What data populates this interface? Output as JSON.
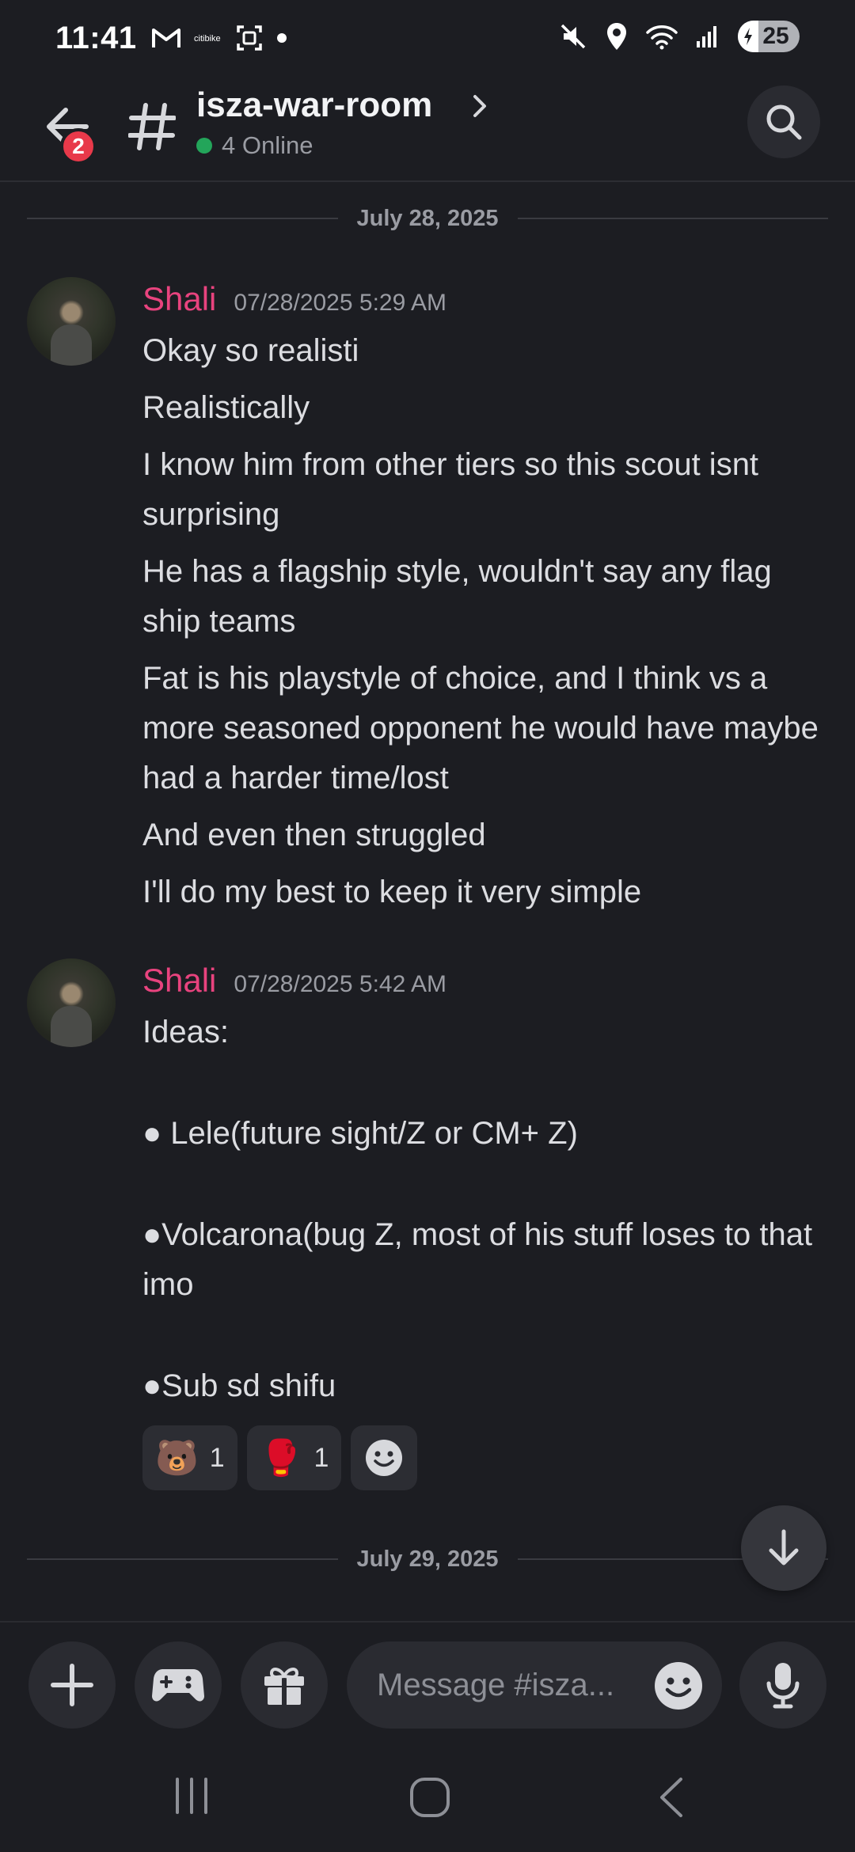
{
  "status_bar": {
    "time": "11:41",
    "battery": "25",
    "left_icons": [
      "gmail-icon",
      "citibike-icon",
      "screenshot-icon",
      "dot-icon"
    ],
    "right_icons": [
      "mute-icon",
      "location-icon",
      "wifi-icon",
      "signal-icon"
    ]
  },
  "header": {
    "badge_count": "2",
    "channel_name": "isza-war-room",
    "online_text": "4 Online",
    "colors": {
      "online": "#23a55a",
      "badge": "#e8394a"
    }
  },
  "chat": {
    "dividers": [
      "July 28, 2025",
      "July 29, 2025"
    ],
    "messages": [
      {
        "author": "Shali",
        "timestamp": "07/28/2025 5:29 AM",
        "lines": [
          "Okay so realisti",
          "Realistically",
          "I know him from other tiers so this scout isnt surprising",
          "He has a flagship style, wouldn't say any flag ship teams",
          "Fat is his playstyle of choice, and I think vs a more seasoned opponent he would have maybe had a harder time/lost",
          "And even then struggled",
          "I'll do my best to keep it very simple"
        ]
      },
      {
        "author": "Shali",
        "timestamp": "07/28/2025 5:42 AM",
        "lines": [
          "Ideas:",
          "● Lele(future sight/Z or CM+ Z)",
          "●Volcarona(bug Z, most of his stuff loses to that imo",
          "●Sub sd shifu"
        ],
        "reactions": [
          {
            "emoji": "🐻",
            "count": "1"
          },
          {
            "emoji": "🥊",
            "count": "1"
          }
        ]
      }
    ],
    "author_color": "#e8437e"
  },
  "composer": {
    "placeholder": "Message #isza..."
  }
}
